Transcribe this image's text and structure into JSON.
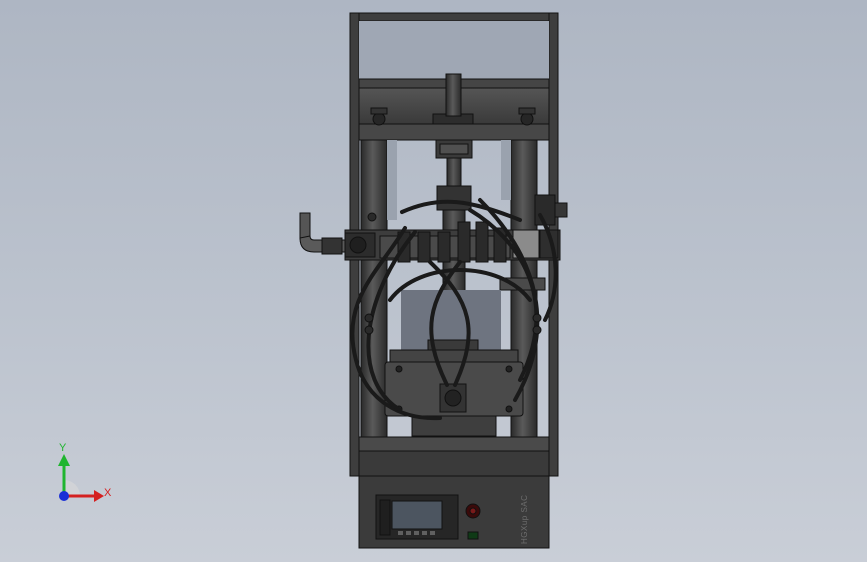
{
  "viewport": {
    "background_top": "#aeb6c3",
    "background_bottom": "#c9ced7"
  },
  "model": {
    "frame_color": "#3a3a3a",
    "edge_color": "#111111",
    "panel_brand": "HGXup SAC"
  },
  "triad": {
    "x_label": "X",
    "y_label": "Y",
    "x_color": "#d42020",
    "y_color": "#1fb52f",
    "z_color": "#1a2fd6"
  }
}
